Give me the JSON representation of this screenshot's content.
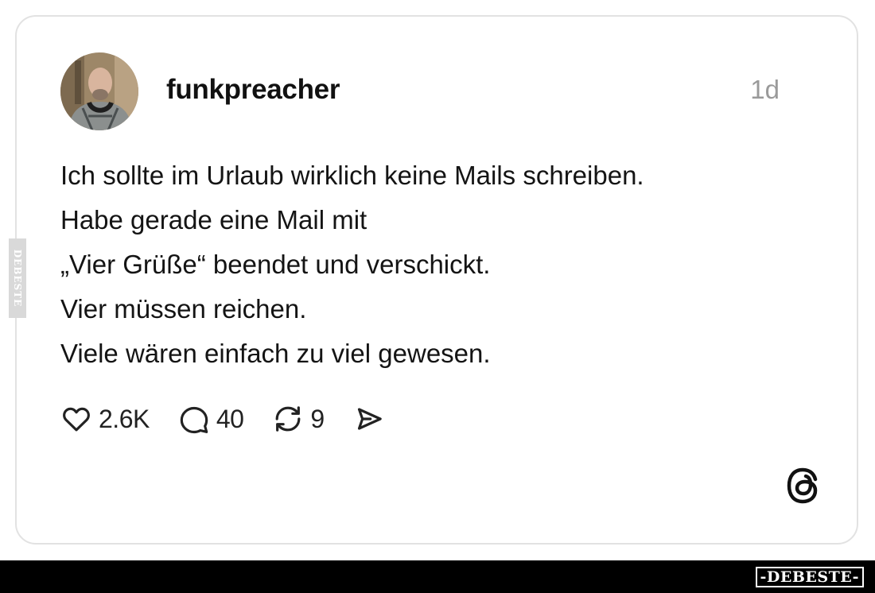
{
  "post": {
    "username": "funkpreacher",
    "time": "1d",
    "lines": [
      "Ich sollte im Urlaub wirklich keine Mails schreiben.",
      "Habe gerade eine Mail mit",
      "„Vier Grüße“ beendet und verschickt.",
      "Vier müssen reichen.",
      "Viele wären einfach zu viel gewesen."
    ]
  },
  "actions": {
    "likes": "2.6K",
    "comments": "40",
    "reposts": "9"
  },
  "icons": {
    "like": "heart-icon",
    "comment": "comment-bubble-icon",
    "repost": "repost-icon",
    "share": "share-icon",
    "platform": "threads-logo-icon"
  },
  "watermark": {
    "side": "DEBESTE",
    "footer": "-DEBESTE-"
  },
  "colors": {
    "card_border": "#e2e2e2",
    "muted_text": "#9a9a9a",
    "footer_bar": "#000000"
  }
}
